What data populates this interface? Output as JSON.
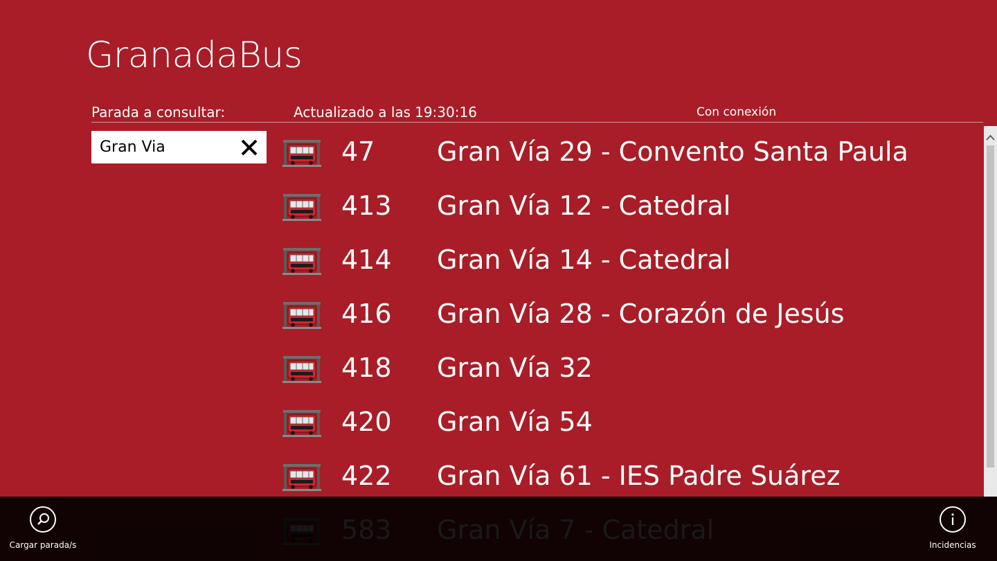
{
  "app": {
    "title": "GranadaBus"
  },
  "header": {
    "stop_label": "Parada a consultar:",
    "updated_label": "Actualizado a las",
    "updated_time": "19:30:16",
    "connection_status": "Con conexión"
  },
  "search": {
    "value": "Gran Via",
    "clear_icon": "close-icon"
  },
  "stops": [
    {
      "number": "47",
      "name": "Gran Vía 29 - Convento Santa Paula",
      "icon": "bus-icon"
    },
    {
      "number": "413",
      "name": "Gran Vía 12 - Catedral",
      "icon": "bus-icon"
    },
    {
      "number": "414",
      "name": "Gran Vía 14 - Catedral",
      "icon": "bus-icon"
    },
    {
      "number": "416",
      "name": "Gran Vía 28 - Corazón de Jesús",
      "icon": "bus-icon"
    },
    {
      "number": "418",
      "name": "Gran Vía 32",
      "icon": "bus-icon"
    },
    {
      "number": "420",
      "name": "Gran Vía 54",
      "icon": "bus-icon"
    },
    {
      "number": "422",
      "name": "Gran Vía 61 - IES Padre Suárez",
      "icon": "bus-icon"
    },
    {
      "number": "583",
      "name": "Gran Vía 7 - Catedral",
      "icon": "bus-icon"
    }
  ],
  "appbar": {
    "load_label": "Cargar parada/s",
    "load_icon": "search-icon",
    "info_label": "Incidencias",
    "info_icon": "info-icon"
  },
  "colors": {
    "background": "#a81d27",
    "text": "#ffffff",
    "appbar": "#0b0000"
  }
}
